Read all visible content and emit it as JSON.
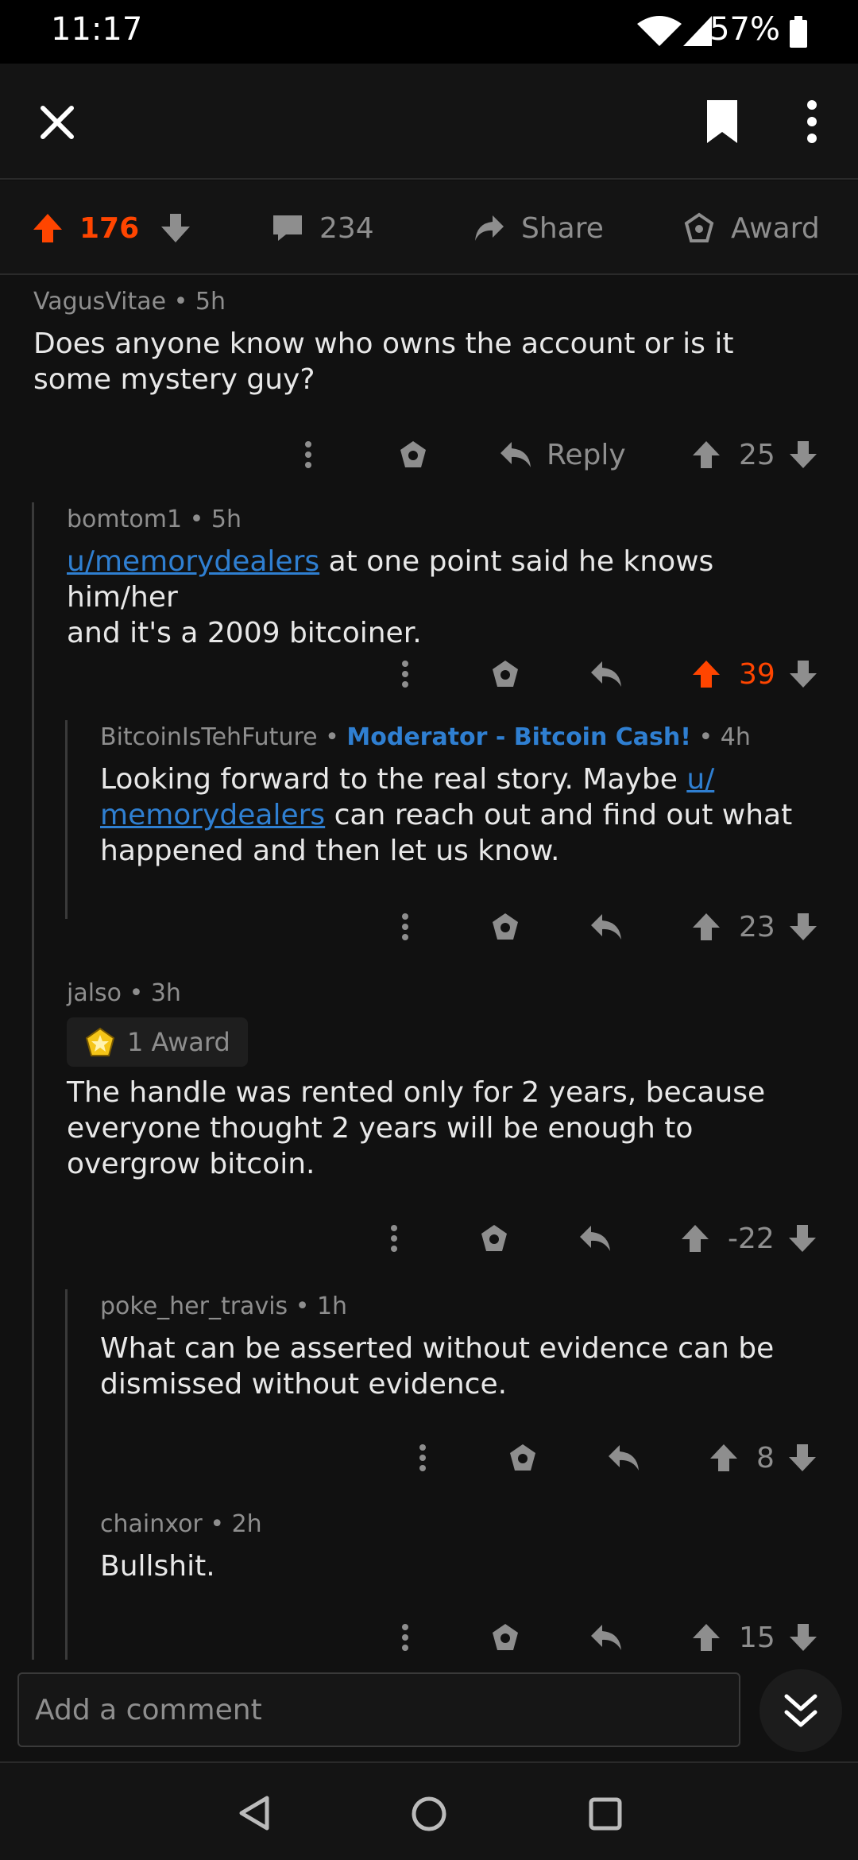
{
  "status_bar": {
    "time": "11:17",
    "battery": "57%"
  },
  "action_bar": {
    "score": "176",
    "comments": "234",
    "share_label": "Share",
    "award_label": "Award"
  },
  "comments": [
    {
      "author": "VagusVitae",
      "sep": "•",
      "age": "5h",
      "body": "Does anyone know who owns the account or is it some mystery guy?",
      "reply_label": "Reply",
      "score": "25"
    },
    {
      "author": "bomtom1",
      "sep": "•",
      "age": "5h",
      "body_link": "u/memorydealers",
      "body_rest_1": " at one point said he knows him/her",
      "body_rest_2": "and it's a 2009 bitcoiner.",
      "score": "39"
    },
    {
      "author": "BitcoinIsTehFuture",
      "sep": "•",
      "flair": "Moderator - Bitcoin Cash!",
      "sep2": "•",
      "age": "4h",
      "body_1": "Looking forward to the real story. Maybe ",
      "body_link_1": "u/",
      "body_link_2": "memorydealers",
      "body_2": " can reach out and find out what",
      "body_3": "happened and then let us know.",
      "score": "23"
    },
    {
      "author": "jalso",
      "sep": "•",
      "age": "3h",
      "award_chip": "1 Award",
      "body": "The handle was rented only for 2 years, because everyone thought 2 years will be enough to overgrow bitcoin.",
      "score": "-22"
    },
    {
      "author": "poke_her_travis",
      "sep": "•",
      "age": "1h",
      "body": "What can be asserted without evidence can be dismissed without evidence.",
      "score": "8"
    },
    {
      "author": "chainxor",
      "sep": "•",
      "age": "2h",
      "body": "Bullshit.",
      "score": "15"
    }
  ],
  "composer": {
    "placeholder": "Add a comment"
  },
  "colors": {
    "accent_orange": "#ff4500",
    "link_blue": "#2f7fd1",
    "background": "#111111"
  }
}
